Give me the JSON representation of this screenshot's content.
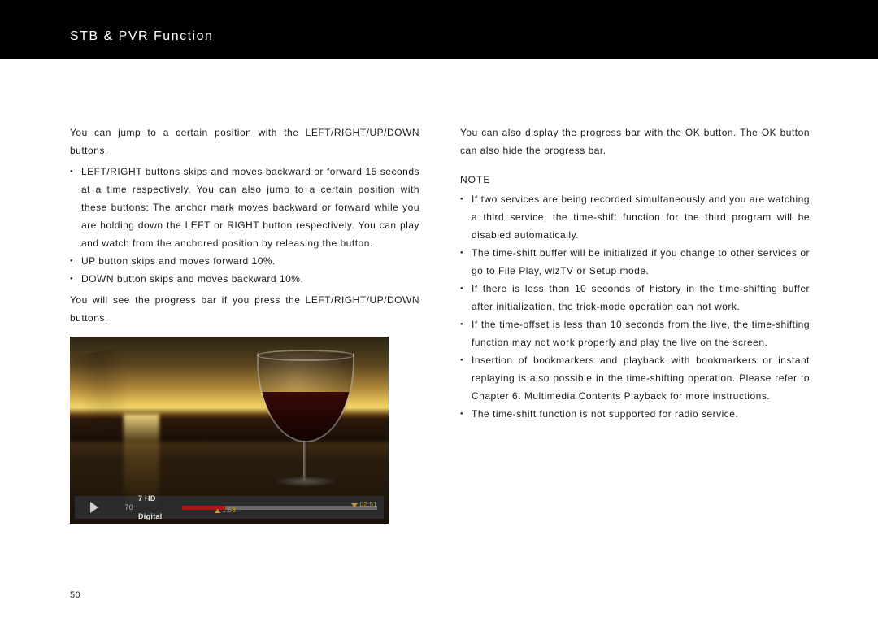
{
  "header": {
    "title": "STB & PVR Function"
  },
  "left": {
    "intro": "You can jump to a certain position with the LEFT/RIGHT/UP/DOWN buttons.",
    "bullets": [
      "LEFT/RIGHT buttons skips and moves backward or forward 15 seconds at a time respectively. You can also jump to a certain position with these buttons: The anchor mark moves backward or forward while you are holding down the LEFT or RIGHT button respectively. You can play and watch from the anchored position by releasing the button.",
      "UP button skips and moves forward 10%.",
      "DOWN button skips and moves backward 10%."
    ],
    "after": "You will see the progress bar if you press the LEFT/RIGHT/UP/DOWN buttons."
  },
  "osd": {
    "channel_number": "70",
    "channel_name": "7 HD Digital",
    "total_time": "02:51",
    "current_time": "1:58"
  },
  "right": {
    "intro": "You can also display the progress bar with the OK button. The OK button can also hide the progress bar.",
    "note_heading": "NOTE",
    "notes": [
      "If two services are being recorded simultaneously and you are watching a third service, the time-shift function for the third program will be disabled automatically.",
      "The time-shift buffer will be initialized if you change to other services or go to File Play, wizTV or Setup mode.",
      "If there is less than 10 seconds of history in the time-shifting buffer after initialization, the trick-mode operation can not work.",
      "If the time-offset is less than 10 seconds from the live, the time-shifting function may not work properly and play the live on the screen.",
      "Insertion of bookmarkers and playback with bookmarkers or instant replaying is also possible in the time-shifting operation. Please refer to Chapter 6. Multimedia Contents Playback for more instructions.",
      "The time-shift function is not supported for radio service."
    ]
  },
  "page_number": "50"
}
